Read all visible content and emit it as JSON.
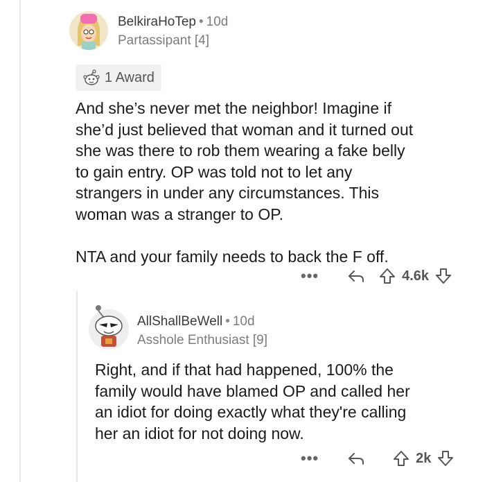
{
  "comments": [
    {
      "username": "BelkiraHoTep",
      "separator": "•",
      "age": "10d",
      "flair": "Partassipant [4]",
      "award_label": "1 Award",
      "body": "And she’s never met the neighbor! Imagine if\nshe’d just believed that woman and it turned out\nshe was there to rob them wearing a fake belly\nto gain entry. OP was told not to let any\nstrangers in under any circumstances. This\nwoman was a stranger to OP.\n\nNTA and your family needs to back the F off.",
      "more": "•••",
      "score": "4.6k",
      "icons": [
        "reply-icon",
        "upvote-icon",
        "downvote-icon"
      ]
    },
    {
      "username": "AllShallBeWell",
      "separator": "•",
      "age": "10d",
      "flair": "Asshole Enthusiast [9]",
      "body": "Right, and if that had happened, 100% the\nfamily would have blamed OP and called her\nan idiot for doing exactly what they're calling\nher an idiot for not doing now.",
      "more": "•••",
      "score": "2k",
      "icons": [
        "reply-icon",
        "upvote-icon",
        "downvote-icon"
      ]
    }
  ],
  "colors": {
    "thread_line": "#e7e7e7",
    "award_bg": "#f1f1f1",
    "text": "#1a1a1b",
    "muted": "#7c7c7c"
  }
}
